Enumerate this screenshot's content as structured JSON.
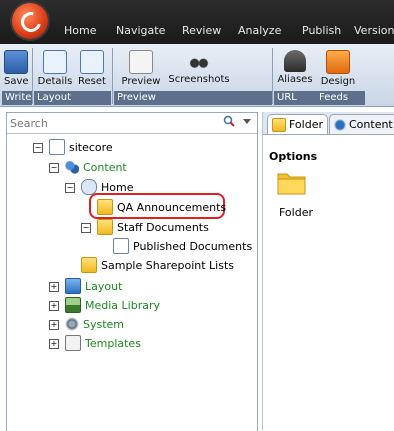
{
  "menubar": {
    "tabs": [
      "Home",
      "Navigate",
      "Review",
      "Analyze",
      "Publish",
      "Version"
    ]
  },
  "ribbon": {
    "buttons": [
      {
        "label": "Save",
        "icon": "save-icon"
      },
      {
        "label": "Details",
        "icon": "details-icon"
      },
      {
        "label": "Reset",
        "icon": "reset-icon"
      },
      {
        "label": "Preview",
        "icon": "preview-icon"
      },
      {
        "label": "Screenshots",
        "icon": "binoculars-icon"
      },
      {
        "label": "Aliases",
        "icon": "aliases-icon"
      },
      {
        "label": "Design",
        "icon": "rss-icon"
      }
    ],
    "groups": [
      "Write",
      "Layout",
      "Preview",
      "URL",
      "Feeds"
    ]
  },
  "search": {
    "placeholder": "Search"
  },
  "tree": {
    "root": "sitecore",
    "content": "Content",
    "home": "Home",
    "qa": "QA Announcements",
    "staff": "Staff Documents",
    "published": "Published Documents",
    "sample": "Sample Sharepoint Lists",
    "layout": "Layout",
    "media": "Media Library",
    "system": "System",
    "templates": "Templates"
  },
  "right_pane": {
    "tab_folder": "Folder",
    "tab_content": "Content",
    "options_label": "Options",
    "folder_item": "Folder"
  },
  "colors": {
    "accent_highlight": "#e02020",
    "tree_green": "#1a8a20",
    "ribbon_group": "#5d6f8a"
  }
}
